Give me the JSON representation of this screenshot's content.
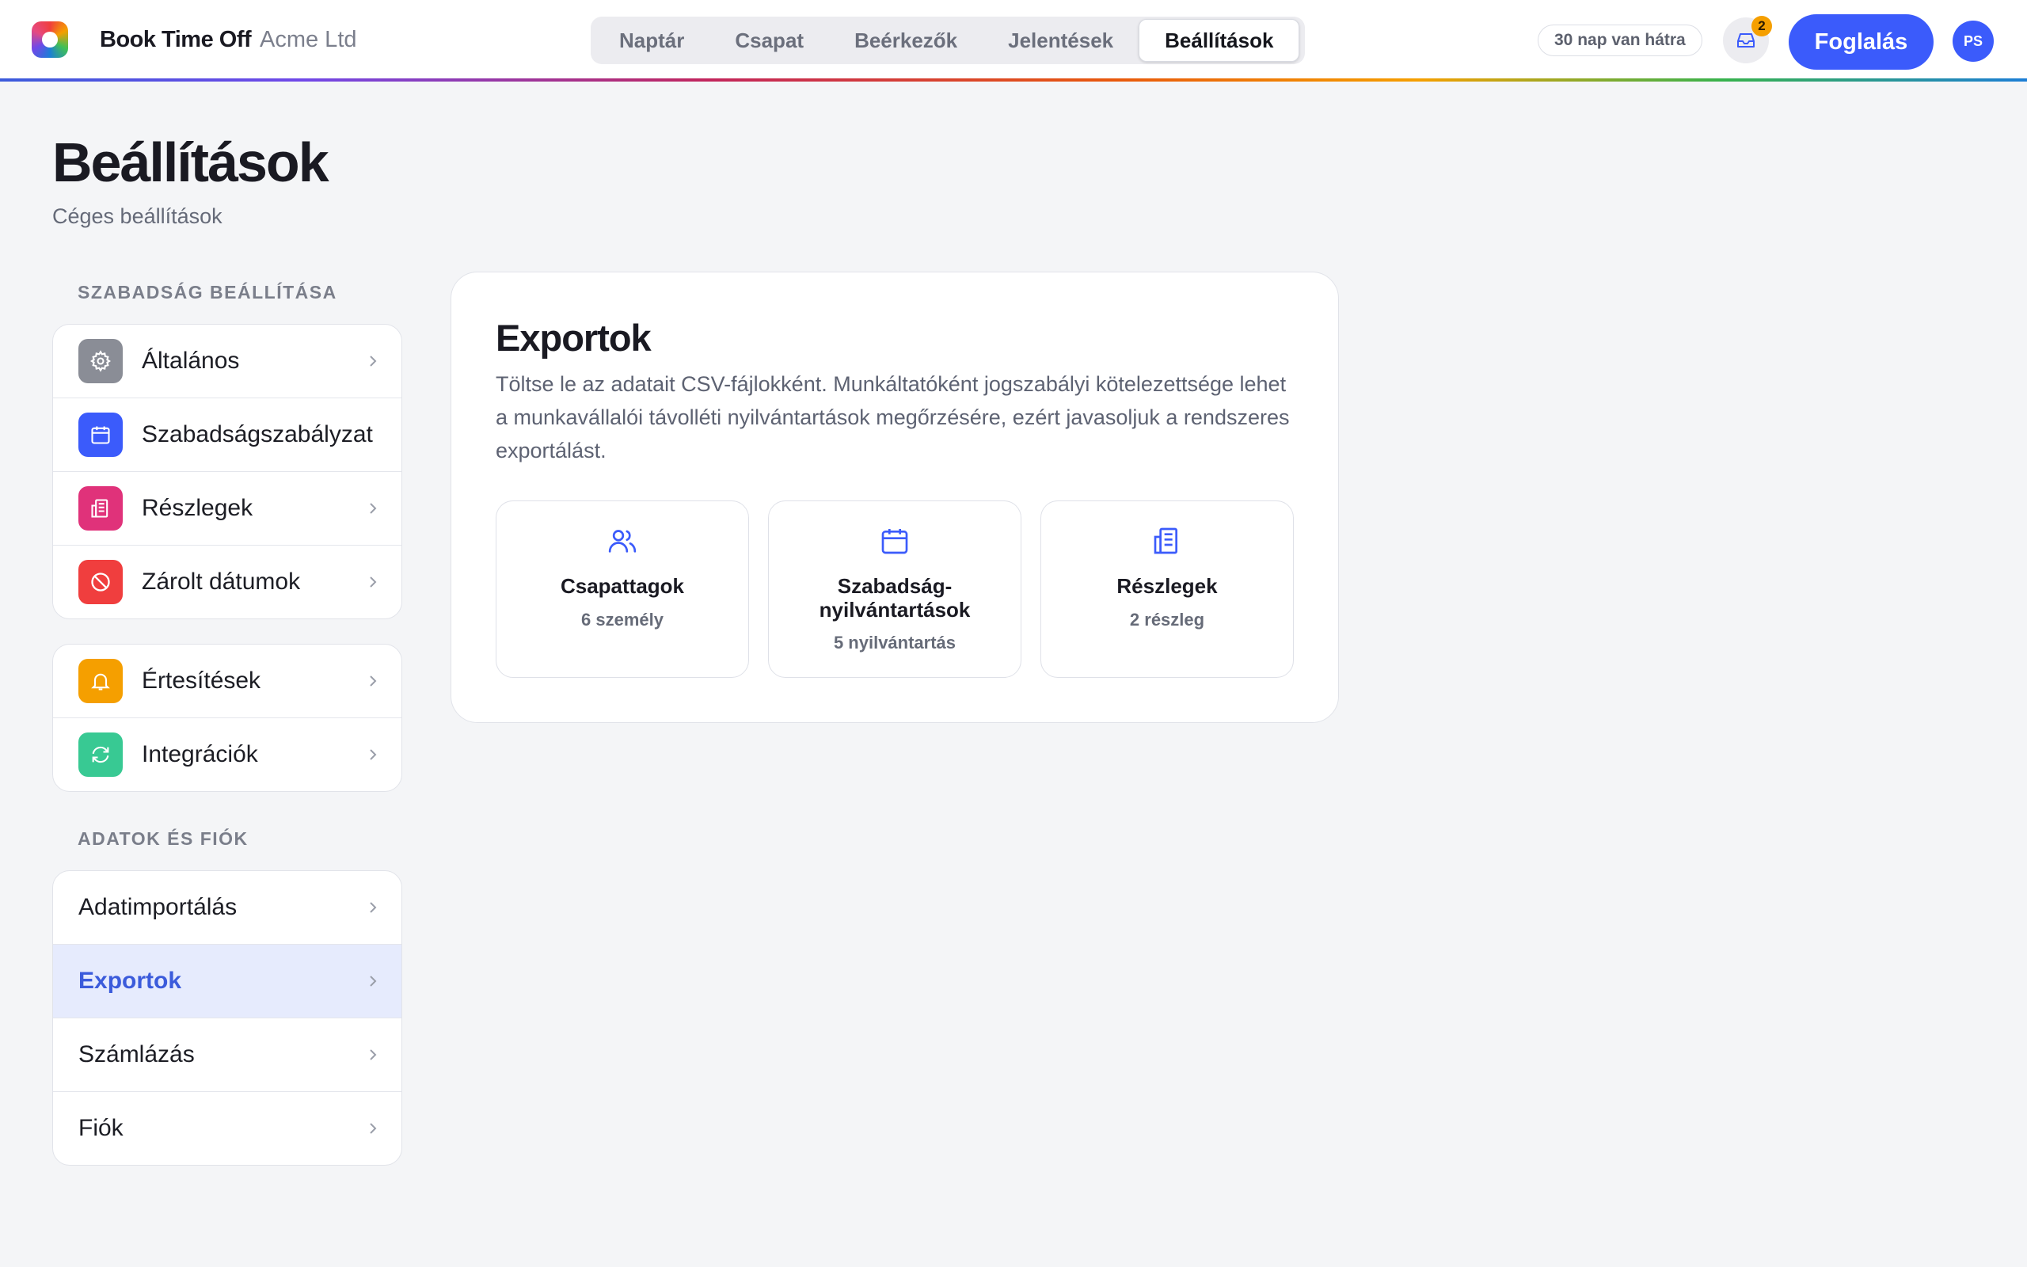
{
  "header": {
    "brand": "Book Time Off",
    "company": "Acme Ltd",
    "tabs": [
      {
        "label": "Naptár"
      },
      {
        "label": "Csapat"
      },
      {
        "label": "Beérkezők"
      },
      {
        "label": "Jelentések"
      },
      {
        "label": "Beállítások",
        "active": true
      }
    ],
    "trial_text": "30 nap van hátra",
    "inbox_count": "2",
    "book_button": "Foglalás",
    "avatar_initials": "PS"
  },
  "page": {
    "title": "Beállítások",
    "subtitle": "Céges beállítások"
  },
  "sidebar": {
    "section1_label": "SZABADSÁG BEÁLLÍTÁSA",
    "group1": [
      {
        "label": "Általános",
        "icon": "gear-icon",
        "color": "#8a8d96"
      },
      {
        "label": "Szabadságszabályzat",
        "icon": "calendar-icon",
        "color": "#3b5bfb"
      },
      {
        "label": "Részlegek",
        "icon": "building-icon",
        "color": "#e0327a"
      },
      {
        "label": "Zárolt dátumok",
        "icon": "block-icon",
        "color": "#f03e3e"
      }
    ],
    "group2": [
      {
        "label": "Értesítések",
        "icon": "bell-icon",
        "color": "#f59f00"
      },
      {
        "label": "Integrációk",
        "icon": "sync-icon",
        "color": "#38c993"
      }
    ],
    "section2_label": "ADATOK ÉS FIÓK",
    "group3": [
      {
        "label": "Adatimportálás"
      },
      {
        "label": "Exportok",
        "active": true
      },
      {
        "label": "Számlázás"
      },
      {
        "label": "Fiók"
      }
    ]
  },
  "exports": {
    "title": "Exportok",
    "description": "Töltse le az adatait CSV-fájlokként. Munkáltatóként jogszabályi kötelezettsége lehet a munkavállalói távolléti nyilvántartások megőrzésére, ezért javasoljuk a rendszeres exportálást.",
    "tiles": [
      {
        "title": "Csapattagok",
        "subtitle": "6 személy",
        "icon": "users-icon"
      },
      {
        "title": "Szabadság-nyilvántartások",
        "title_line1": "Szabadság-",
        "title_line2": "nyilvántartások",
        "subtitle": "5 nyilvántartás",
        "icon": "calendar-icon"
      },
      {
        "title": "Részlegek",
        "subtitle": "2 részleg",
        "icon": "building-icon"
      }
    ]
  },
  "colors": {
    "accent": "#3b5bfb",
    "active_bg": "#e6ebfd",
    "background": "#f4f5f7"
  }
}
